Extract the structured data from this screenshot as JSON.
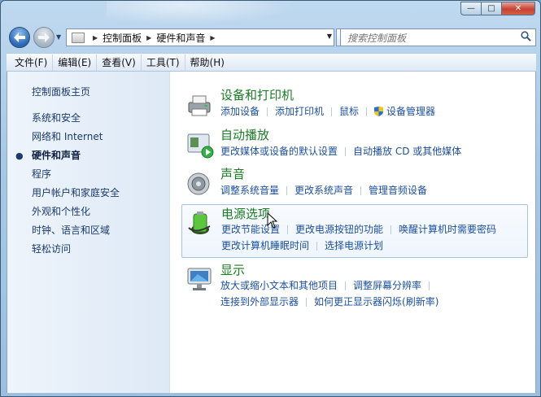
{
  "window": {
    "caption_buttons": {
      "minimize": "—",
      "maximize": "□",
      "close": "✕"
    }
  },
  "nav": {
    "back_icon": "arrow-left",
    "forward_icon": "arrow-right",
    "breadcrumbs": [
      "控制面板",
      "硬件和声音"
    ],
    "search_placeholder": "搜索控制面板"
  },
  "menu": [
    "文件(F)",
    "编辑(E)",
    "查看(V)",
    "工具(T)",
    "帮助(H)"
  ],
  "sidebar": {
    "home": "控制面板主页",
    "items": [
      {
        "label": "系统和安全",
        "current": false
      },
      {
        "label": "网络和 Internet",
        "current": false
      },
      {
        "label": "硬件和声音",
        "current": true
      },
      {
        "label": "程序",
        "current": false
      },
      {
        "label": "用户帐户和家庭安全",
        "current": false
      },
      {
        "label": "外观和个性化",
        "current": false
      },
      {
        "label": "时钟、语言和区域",
        "current": false
      },
      {
        "label": "轻松访问",
        "current": false
      }
    ]
  },
  "categories": [
    {
      "title": "设备和打印机",
      "icon": "printer-icon",
      "lines": [
        [
          "添加设备",
          "添加打印机",
          "鼠标",
          "设备管理器"
        ]
      ]
    },
    {
      "title": "自动播放",
      "icon": "autoplay-icon",
      "lines": [
        [
          "更改媒体或设备的默认设置",
          "自动播放 CD 或其他媒体"
        ]
      ]
    },
    {
      "title": "声音",
      "icon": "speaker-icon",
      "lines": [
        [
          "调整系统音量",
          "更改系统声音",
          "管理音频设备"
        ]
      ]
    },
    {
      "title": "电源选项",
      "icon": "battery-icon",
      "lines": [
        [
          "更改节能设置",
          "更改电源按钮的功能",
          "唤醒计算机时需要密码"
        ],
        [
          "更改计算机睡眠时间",
          "选择电源计划"
        ]
      ]
    },
    {
      "title": "显示",
      "icon": "monitor-icon",
      "lines": [
        [
          "放大或缩小文本和其他项目",
          "调整屏幕分辨率"
        ],
        [
          "连接到外部显示器",
          "如何更正显示器闪烁(刷新率)"
        ]
      ]
    }
  ],
  "colors": {
    "title_green": "#1b7c25",
    "link_blue": "#1c4f9c",
    "sidebar_text": "#1c3a6d"
  }
}
